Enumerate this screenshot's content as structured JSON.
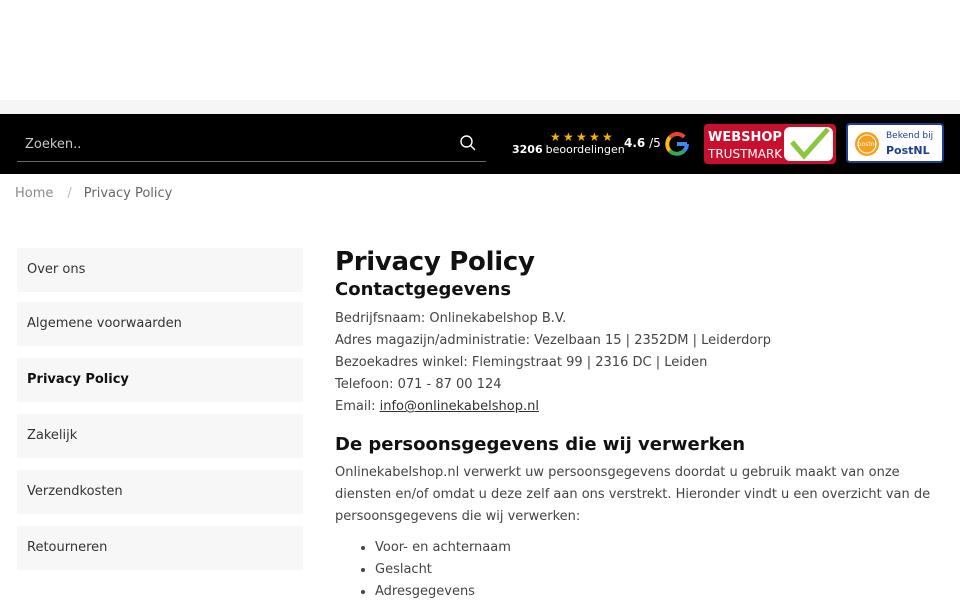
{
  "search": {
    "placeholder": "Zoeken.."
  },
  "reviews": {
    "count": "3206",
    "label": "beoordelingen",
    "rating": "4.6",
    "rating_max": "/5",
    "stars": 5
  },
  "badges": {
    "trustmark": {
      "line1": "WEBSHOP",
      "line2": "TRUSTMARK"
    },
    "postnl": {
      "top": "Bekend bij",
      "bottom": "PostNL",
      "logo_text": "postnl"
    }
  },
  "breadcrumb": {
    "home": "Home",
    "separator": "/",
    "current": "Privacy Policy"
  },
  "sidebar": {
    "items": [
      {
        "label": "Over ons",
        "active": false
      },
      {
        "label": "Algemene voorwaarden",
        "active": false
      },
      {
        "label": "Privacy Policy",
        "active": true
      },
      {
        "label": "Zakelijk",
        "active": false
      },
      {
        "label": "Verzendkosten",
        "active": false
      },
      {
        "label": "Retourneren",
        "active": false
      }
    ]
  },
  "content": {
    "title": "Privacy Policy",
    "contact_heading": "Contactgegevens",
    "contact": {
      "company": "Bedrijfsnaam: Onlinekabelshop B.V.",
      "address": "Adres magazijn/administratie: Vezelbaan 15 | 2352DM | Leiderdorp",
      "visit": "Bezoekadres winkel: Flemingstraat 99 | 2316 DC | Leiden",
      "phone": "Telefoon: 071 - 87 00 124",
      "email_label": "Email: ",
      "email": "info@onlinekabelshop.nl"
    },
    "section_heading": "De persoonsgegevens die wij verwerken",
    "intro": "Onlinekabelshop.nl verwerkt uw persoonsgegevens doordat u gebruik maakt van onze diensten en/of omdat u deze zelf aan ons verstrekt. Hieronder vindt u een overzicht van de persoonsgegevens die wij verwerken:",
    "bullets": [
      "Voor- en achternaam",
      "Geslacht",
      "Adresgegevens"
    ]
  },
  "colors": {
    "header_bg": "#000000",
    "star": "#f4b400",
    "postnl_blue": "#1d3f8f",
    "trustmark_red": "#c8102e"
  }
}
